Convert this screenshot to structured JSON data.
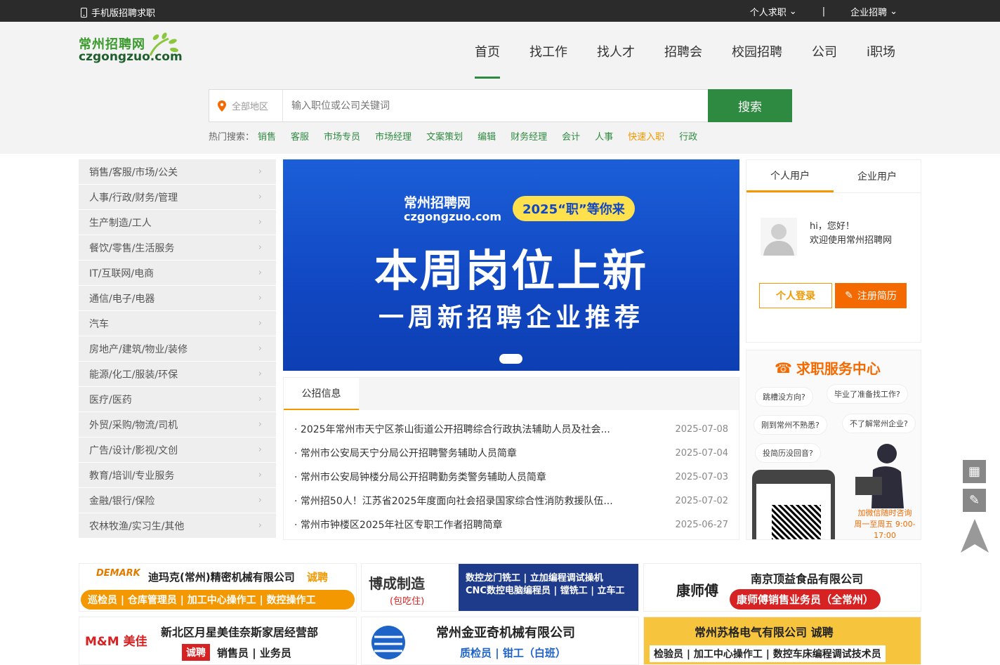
{
  "topbar": {
    "mobile": "手机版招聘求职",
    "personal": "个人求职",
    "enterprise": "企业招聘"
  },
  "logo": {
    "name": "常州招聘网",
    "domain": "czgongzuo.com"
  },
  "nav": [
    "首页",
    "找工作",
    "找人才",
    "招聘会",
    "校园招聘",
    "公司",
    "i职场"
  ],
  "search": {
    "area": "全部地区",
    "placeholder": "输入职位或公司关键词",
    "button": "搜索"
  },
  "hot": {
    "label": "热门搜索：",
    "items": [
      "销售",
      "客服",
      "市场专员",
      "市场经理",
      "文案策划",
      "编辑",
      "财务经理",
      "会计",
      "人事",
      "快速入职",
      "行政"
    ]
  },
  "categories": [
    "销售/客服/市场/公关",
    "人事/行政/财务/管理",
    "生产制造/工人",
    "餐饮/零售/生活服务",
    "IT/互联网/电商",
    "通信/电子/电器",
    "汽车",
    "房地产/建筑/物业/装修",
    "能源/化工/服装/环保",
    "医疗/医药",
    "外贸/采购/物流/司机",
    "广告/设计/影视/文创",
    "教育/培训/专业服务",
    "金融/银行/保险",
    "农林牧渔/实习生/其他"
  ],
  "banner": {
    "brand": "常州招聘网",
    "domain": "czgongzuo.com",
    "pill": "2025“职”等你来",
    "headline": "本周岗位上新",
    "sub": "一周新招聘企业推荐"
  },
  "notice": {
    "tab": "公招信息",
    "rows": [
      {
        "title": "2025年常州市天宁区茶山街道公开招聘综合行政执法辅助人员及社会...",
        "date": "2025-07-08"
      },
      {
        "title": "常州市公安局天宁分局公开招聘警务辅助人员简章",
        "date": "2025-07-04"
      },
      {
        "title": "常州市公安局钟楼分局公开招聘勤务类警务辅助人员简章",
        "date": "2025-07-03"
      },
      {
        "title": "常州招50人！江苏省2025年度面向社会招录国家综合性消防救援队伍...",
        "date": "2025-07-02"
      },
      {
        "title": "常州市钟楼区2025年社区专职工作者招聘简章",
        "date": "2025-06-27"
      }
    ]
  },
  "user": {
    "tab_personal": "个人用户",
    "tab_enterprise": "企业用户",
    "hi": "hi，您好！",
    "welcome": "欢迎使用常州招聘网",
    "login": "个人登录",
    "register": "注册简历"
  },
  "service": {
    "title": "求职服务中心",
    "q1": "跳槽没方向?",
    "q2": "毕业了准备找工作?",
    "q3": "刚到常州不熟悉?",
    "q4": "不了解常州企业?",
    "q5": "投简历没回音?",
    "cta1": "加微信随时咨询",
    "cta2": "周一至周五 9:00-17:00"
  },
  "ads": {
    "a1": {
      "logo": "DEMARK",
      "name": "迪玛克(常州)精密机械有限公司",
      "tag": "诚聘",
      "jobs": "巡检员 | 仓库管理员 | 加工中心操作工 | 数控操作工"
    },
    "a2": {
      "logo": "博成制造",
      "sub": "(包吃住)",
      "l1": "数控龙门铣工 | 立加编程调试操机",
      "l2": "CNC数控电脑编程员 | 镗铣工 | 立车工"
    },
    "a3": {
      "logo": "康师傅",
      "name": "南京顶益食品有限公司",
      "jobs": "康师傅销售业务员（全常州）"
    },
    "a4": {
      "logo": "M&M 美佳",
      "name": "新北区月星美佳奈斯家居经营部",
      "tag": "诚聘",
      "jobs": "销售员 | 业务员"
    },
    "a5": {
      "name": "常州金亚奇机械有限公司",
      "jobs": "质检员 | 钳工（白班）"
    },
    "a6": {
      "name": "常州苏格电气有限公司 诚聘",
      "jobs": "检验员 | 加工中心操作工 | 数控车床编程调试技术员"
    }
  }
}
